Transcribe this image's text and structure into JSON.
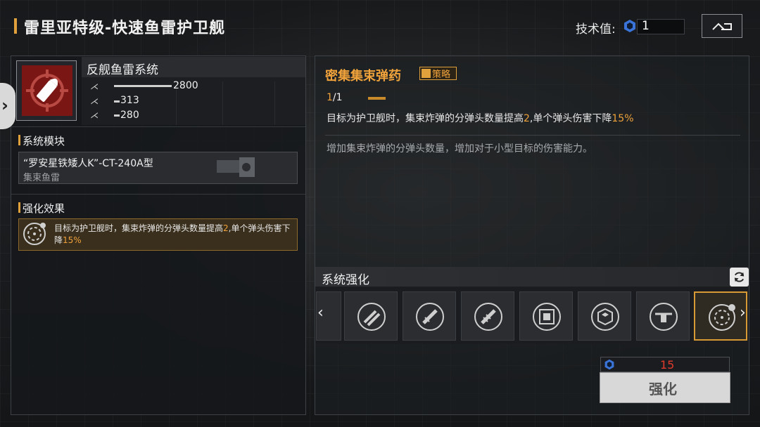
{
  "header": {
    "title": "雷里亚特级-快速鱼雷护卫舰",
    "tech_label": "技术值:",
    "tech_value": "1",
    "back_icon": "return-icon"
  },
  "system": {
    "name": "反舰鱼雷系统",
    "icon": "torpedo-target-icon",
    "stats": [
      {
        "icon": "damage-icon",
        "value": "2800"
      },
      {
        "icon": "damage-icon",
        "value": "313"
      },
      {
        "icon": "damage-icon",
        "value": "280"
      }
    ]
  },
  "module": {
    "section_label": "系统模块",
    "name": "“罗安星铁矮人K”-CT-240A型",
    "type": "集束鱼雷"
  },
  "effect": {
    "section_label": "强化效果",
    "text_before": "目标为护卫舰时，集束炸弹的分弹头数量提高",
    "num1": "2",
    "text_mid": ",单个弹头伤害下降",
    "num2": "15%"
  },
  "tactic": {
    "title": "密集集束弹药",
    "badge": "策略",
    "level_current": "1",
    "level_total": "/1",
    "desc_before": "目标为护卫舰时，集束炸弹的分弹头数量提高",
    "desc_num1": "2",
    "desc_mid": ",单个弹头伤害下降",
    "desc_num2": "15%",
    "desc_sub": "增加集束炸弹的分弹头数量，增加对于小型目标的伤害能力。"
  },
  "enhancement": {
    "label": "系统强化",
    "left_arrow": "‹",
    "right_arrow": "›",
    "slots": [
      "missile-pair-icon",
      "missile-launch-icon",
      "missile-launch-icon",
      "chip-icon",
      "cube-hex-icon",
      "drone-icon",
      "cluster-target-icon"
    ],
    "selected_index": 6
  },
  "cost": {
    "value": "15",
    "button_label": "强化"
  },
  "colors": {
    "accent": "#e0a13c",
    "cost_red": "#e03a2c",
    "weapon_red": "#7a1714"
  }
}
